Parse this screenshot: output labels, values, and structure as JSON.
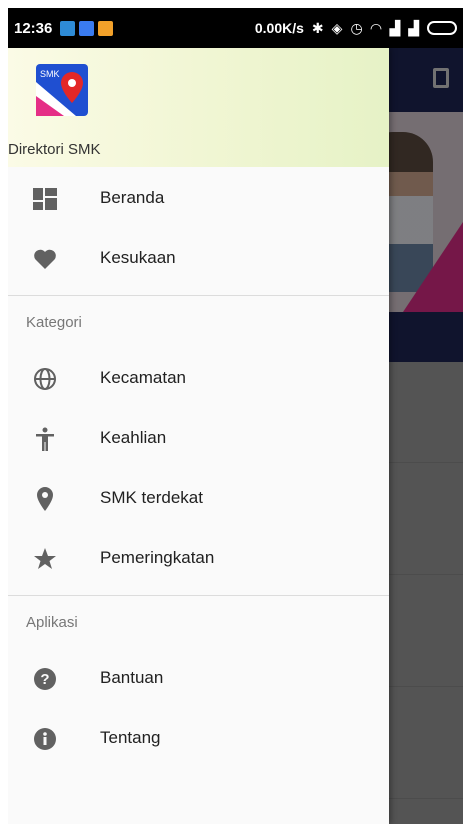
{
  "statusbar": {
    "time": "12:36",
    "network_speed": "0.00K/s"
  },
  "app": {
    "logo_text": "SMK",
    "name": "Direktori SMK"
  },
  "menu": {
    "main": [
      {
        "label": "Beranda",
        "icon": "dashboard-icon"
      },
      {
        "label": "Kesukaan",
        "icon": "heart-icon"
      }
    ],
    "kategori_label": "Kategori",
    "kategori": [
      {
        "label": "Kecamatan",
        "icon": "globe-icon"
      },
      {
        "label": "Keahlian",
        "icon": "accessibility-icon"
      },
      {
        "label": "SMK terdekat",
        "icon": "location-pin-icon"
      },
      {
        "label": "Pemeringkatan",
        "icon": "star-icon"
      }
    ],
    "aplikasi_label": "Aplikasi",
    "aplikasi": [
      {
        "label": "Bantuan",
        "icon": "help-icon"
      },
      {
        "label": "Tentang",
        "icon": "info-icon"
      }
    ]
  },
  "colors": {
    "toolbar": "#1e2553",
    "icon": "#616161",
    "accent_pink": "#d62a83",
    "logo_blue": "#1f4fd1",
    "pin_red": "#e32727"
  }
}
